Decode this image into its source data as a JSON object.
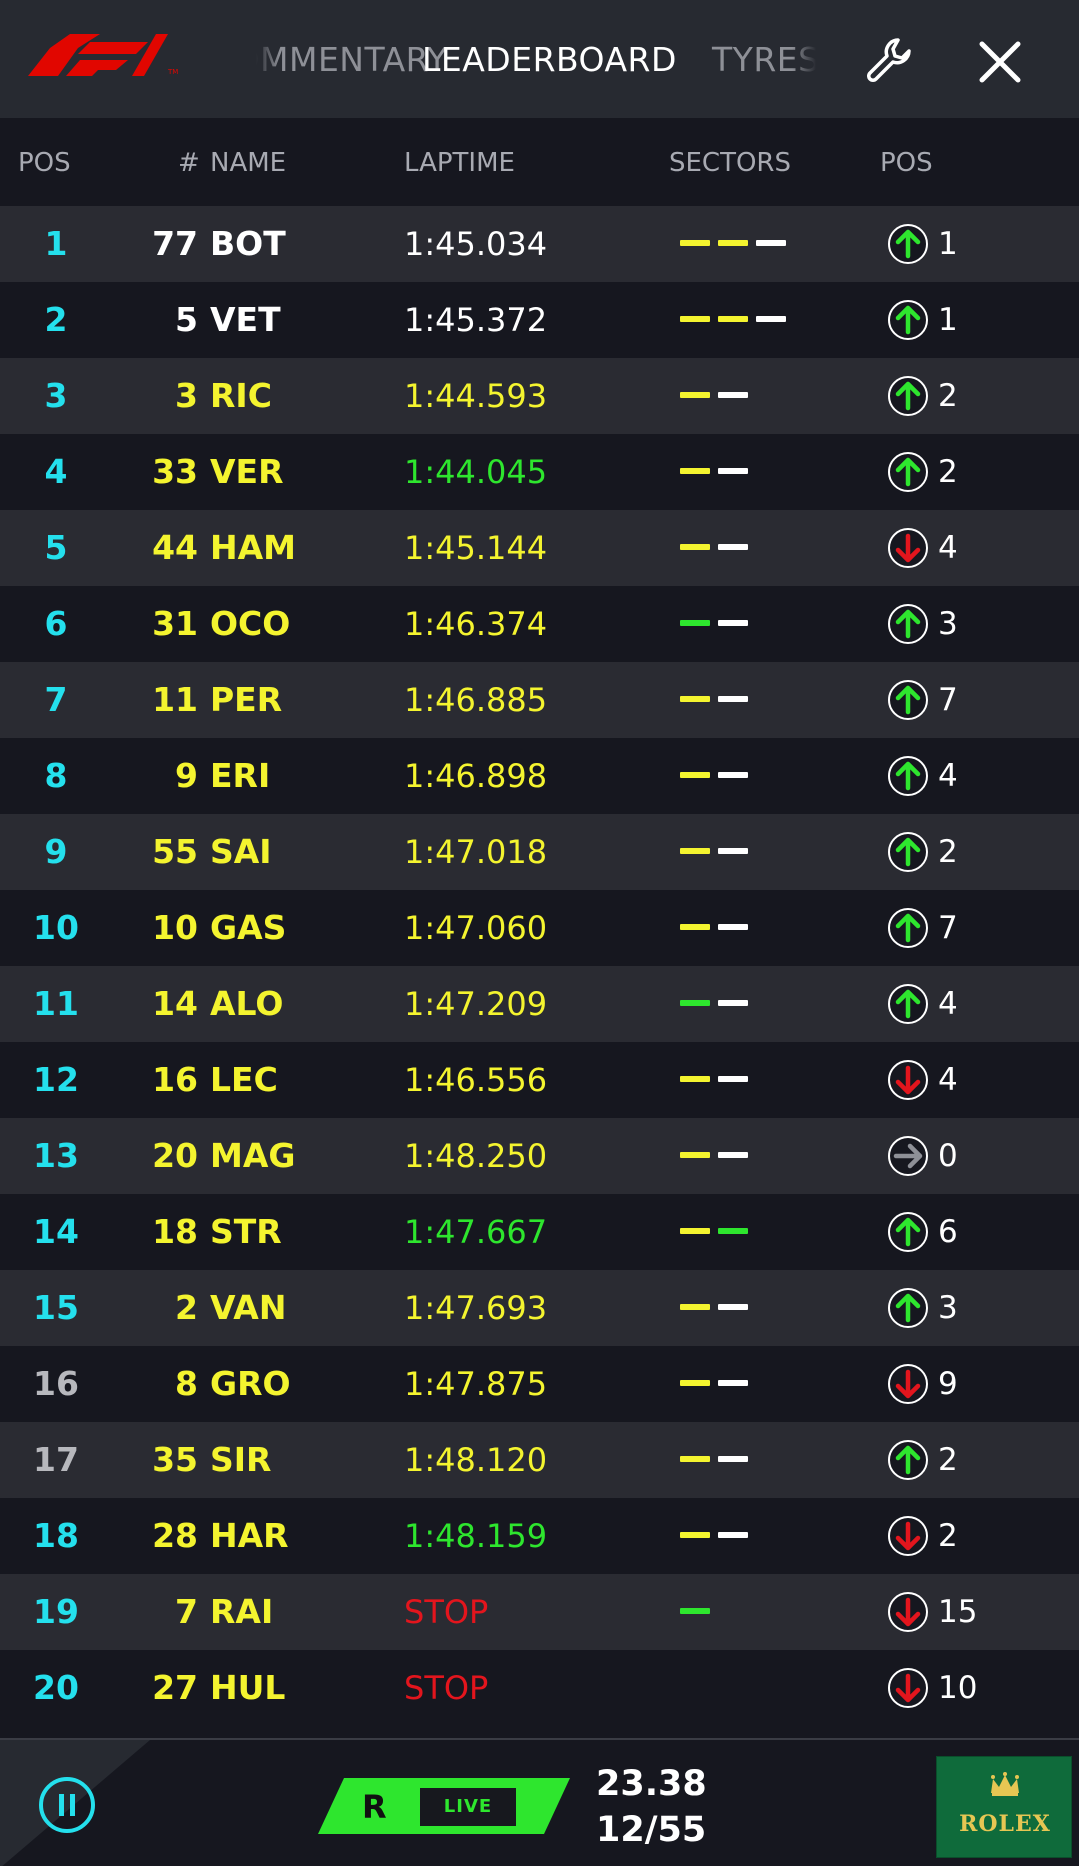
{
  "colors": {
    "cyan": "#24e0ed",
    "yellow": "#f4f42f",
    "green": "#2ee62e",
    "red": "#e3151d",
    "f1_red": "#e10600",
    "topbar_bg": "#272a31",
    "row_alt_bg": "#2a2b32",
    "row_bg": "#16171f"
  },
  "topbar": {
    "logo_icon": "f1-logo",
    "tabs": [
      "COMMENTARY",
      "LEADERBOARD",
      "TYRES"
    ],
    "active_tab": "LEADERBOARD",
    "settings_icon": "wrench-icon",
    "close_icon": "close-icon"
  },
  "header": {
    "pos": "POS",
    "num": "#",
    "name": "NAME",
    "laptime": "LAPTIME",
    "sectors": "SECTORS",
    "pos_change": "POS"
  },
  "rows": [
    {
      "pos": "1",
      "num": "77",
      "name": "BOT",
      "lap": "1:45.034",
      "lap_color": "white",
      "name_color": "white",
      "pos_color": "cyan",
      "sectors": [
        "yellow",
        "yellow",
        "white"
      ],
      "dir": "up",
      "change": "1"
    },
    {
      "pos": "2",
      "num": "5",
      "name": "VET",
      "lap": "1:45.372",
      "lap_color": "white",
      "name_color": "white",
      "pos_color": "cyan",
      "sectors": [
        "yellow",
        "yellow",
        "white"
      ],
      "dir": "up",
      "change": "1"
    },
    {
      "pos": "3",
      "num": "3",
      "name": "RIC",
      "lap": "1:44.593",
      "lap_color": "yellow",
      "name_color": "yellow",
      "pos_color": "cyan",
      "sectors": [
        "yellow",
        "white"
      ],
      "dir": "up",
      "change": "2"
    },
    {
      "pos": "4",
      "num": "33",
      "name": "VER",
      "lap": "1:44.045",
      "lap_color": "green",
      "name_color": "yellow",
      "pos_color": "cyan",
      "sectors": [
        "yellow",
        "white"
      ],
      "dir": "up",
      "change": "2"
    },
    {
      "pos": "5",
      "num": "44",
      "name": "HAM",
      "lap": "1:45.144",
      "lap_color": "yellow",
      "name_color": "yellow",
      "pos_color": "cyan",
      "sectors": [
        "yellow",
        "white"
      ],
      "dir": "down",
      "change": "4"
    },
    {
      "pos": "6",
      "num": "31",
      "name": "OCO",
      "lap": "1:46.374",
      "lap_color": "yellow",
      "name_color": "yellow",
      "pos_color": "cyan",
      "sectors": [
        "green",
        "white"
      ],
      "dir": "up",
      "change": "3"
    },
    {
      "pos": "7",
      "num": "11",
      "name": "PER",
      "lap": "1:46.885",
      "lap_color": "yellow",
      "name_color": "yellow",
      "pos_color": "cyan",
      "sectors": [
        "yellow",
        "white"
      ],
      "dir": "up",
      "change": "7"
    },
    {
      "pos": "8",
      "num": "9",
      "name": "ERI",
      "lap": "1:46.898",
      "lap_color": "yellow",
      "name_color": "yellow",
      "pos_color": "cyan",
      "sectors": [
        "yellow",
        "white"
      ],
      "dir": "up",
      "change": "4"
    },
    {
      "pos": "9",
      "num": "55",
      "name": "SAI",
      "lap": "1:47.018",
      "lap_color": "yellow",
      "name_color": "yellow",
      "pos_color": "cyan",
      "sectors": [
        "yellow",
        "white"
      ],
      "dir": "up",
      "change": "2"
    },
    {
      "pos": "10",
      "num": "10",
      "name": "GAS",
      "lap": "1:47.060",
      "lap_color": "yellow",
      "name_color": "yellow",
      "pos_color": "cyan",
      "sectors": [
        "yellow",
        "white"
      ],
      "dir": "up",
      "change": "7"
    },
    {
      "pos": "11",
      "num": "14",
      "name": "ALO",
      "lap": "1:47.209",
      "lap_color": "yellow",
      "name_color": "yellow",
      "pos_color": "cyan",
      "sectors": [
        "green",
        "white"
      ],
      "dir": "up",
      "change": "4"
    },
    {
      "pos": "12",
      "num": "16",
      "name": "LEC",
      "lap": "1:46.556",
      "lap_color": "yellow",
      "name_color": "yellow",
      "pos_color": "cyan",
      "sectors": [
        "yellow",
        "white"
      ],
      "dir": "down",
      "change": "4"
    },
    {
      "pos": "13",
      "num": "20",
      "name": "MAG",
      "lap": "1:48.250",
      "lap_color": "yellow",
      "name_color": "yellow",
      "pos_color": "cyan",
      "sectors": [
        "yellow",
        "white"
      ],
      "dir": "same",
      "change": "0"
    },
    {
      "pos": "14",
      "num": "18",
      "name": "STR",
      "lap": "1:47.667",
      "lap_color": "green",
      "name_color": "yellow",
      "pos_color": "cyan",
      "sectors": [
        "yellow",
        "green"
      ],
      "dir": "up",
      "change": "6"
    },
    {
      "pos": "15",
      "num": "2",
      "name": "VAN",
      "lap": "1:47.693",
      "lap_color": "yellow",
      "name_color": "yellow",
      "pos_color": "cyan",
      "sectors": [
        "yellow",
        "white"
      ],
      "dir": "up",
      "change": "3"
    },
    {
      "pos": "16",
      "num": "8",
      "name": "GRO",
      "lap": "1:47.875",
      "lap_color": "yellow",
      "name_color": "yellow",
      "pos_color": "grey",
      "sectors": [
        "yellow",
        "white"
      ],
      "dir": "down",
      "change": "9"
    },
    {
      "pos": "17",
      "num": "35",
      "name": "SIR",
      "lap": "1:48.120",
      "lap_color": "yellow",
      "name_color": "yellow",
      "pos_color": "grey",
      "sectors": [
        "yellow",
        "white"
      ],
      "dir": "up",
      "change": "2"
    },
    {
      "pos": "18",
      "num": "28",
      "name": "HAR",
      "lap": "1:48.159",
      "lap_color": "green",
      "name_color": "yellow",
      "pos_color": "cyan",
      "sectors": [
        "yellow",
        "white"
      ],
      "dir": "down",
      "change": "2"
    },
    {
      "pos": "19",
      "num": "7",
      "name": "RAI",
      "lap": "STOP",
      "lap_color": "red",
      "name_color": "yellow",
      "pos_color": "cyan",
      "sectors": [
        "green"
      ],
      "dir": "down",
      "change": "15"
    },
    {
      "pos": "20",
      "num": "27",
      "name": "HUL",
      "lap": "STOP",
      "lap_color": "red",
      "name_color": "yellow",
      "pos_color": "cyan",
      "sectors": [],
      "dir": "down",
      "change": "10"
    }
  ],
  "bottombar": {
    "pause_icon": "pause-icon",
    "live_letter": "R",
    "live_label": "LIVE",
    "time": "23.38",
    "laps": "12/55",
    "sponsor": "ROLEX",
    "sponsor_icon": "crown-icon"
  }
}
